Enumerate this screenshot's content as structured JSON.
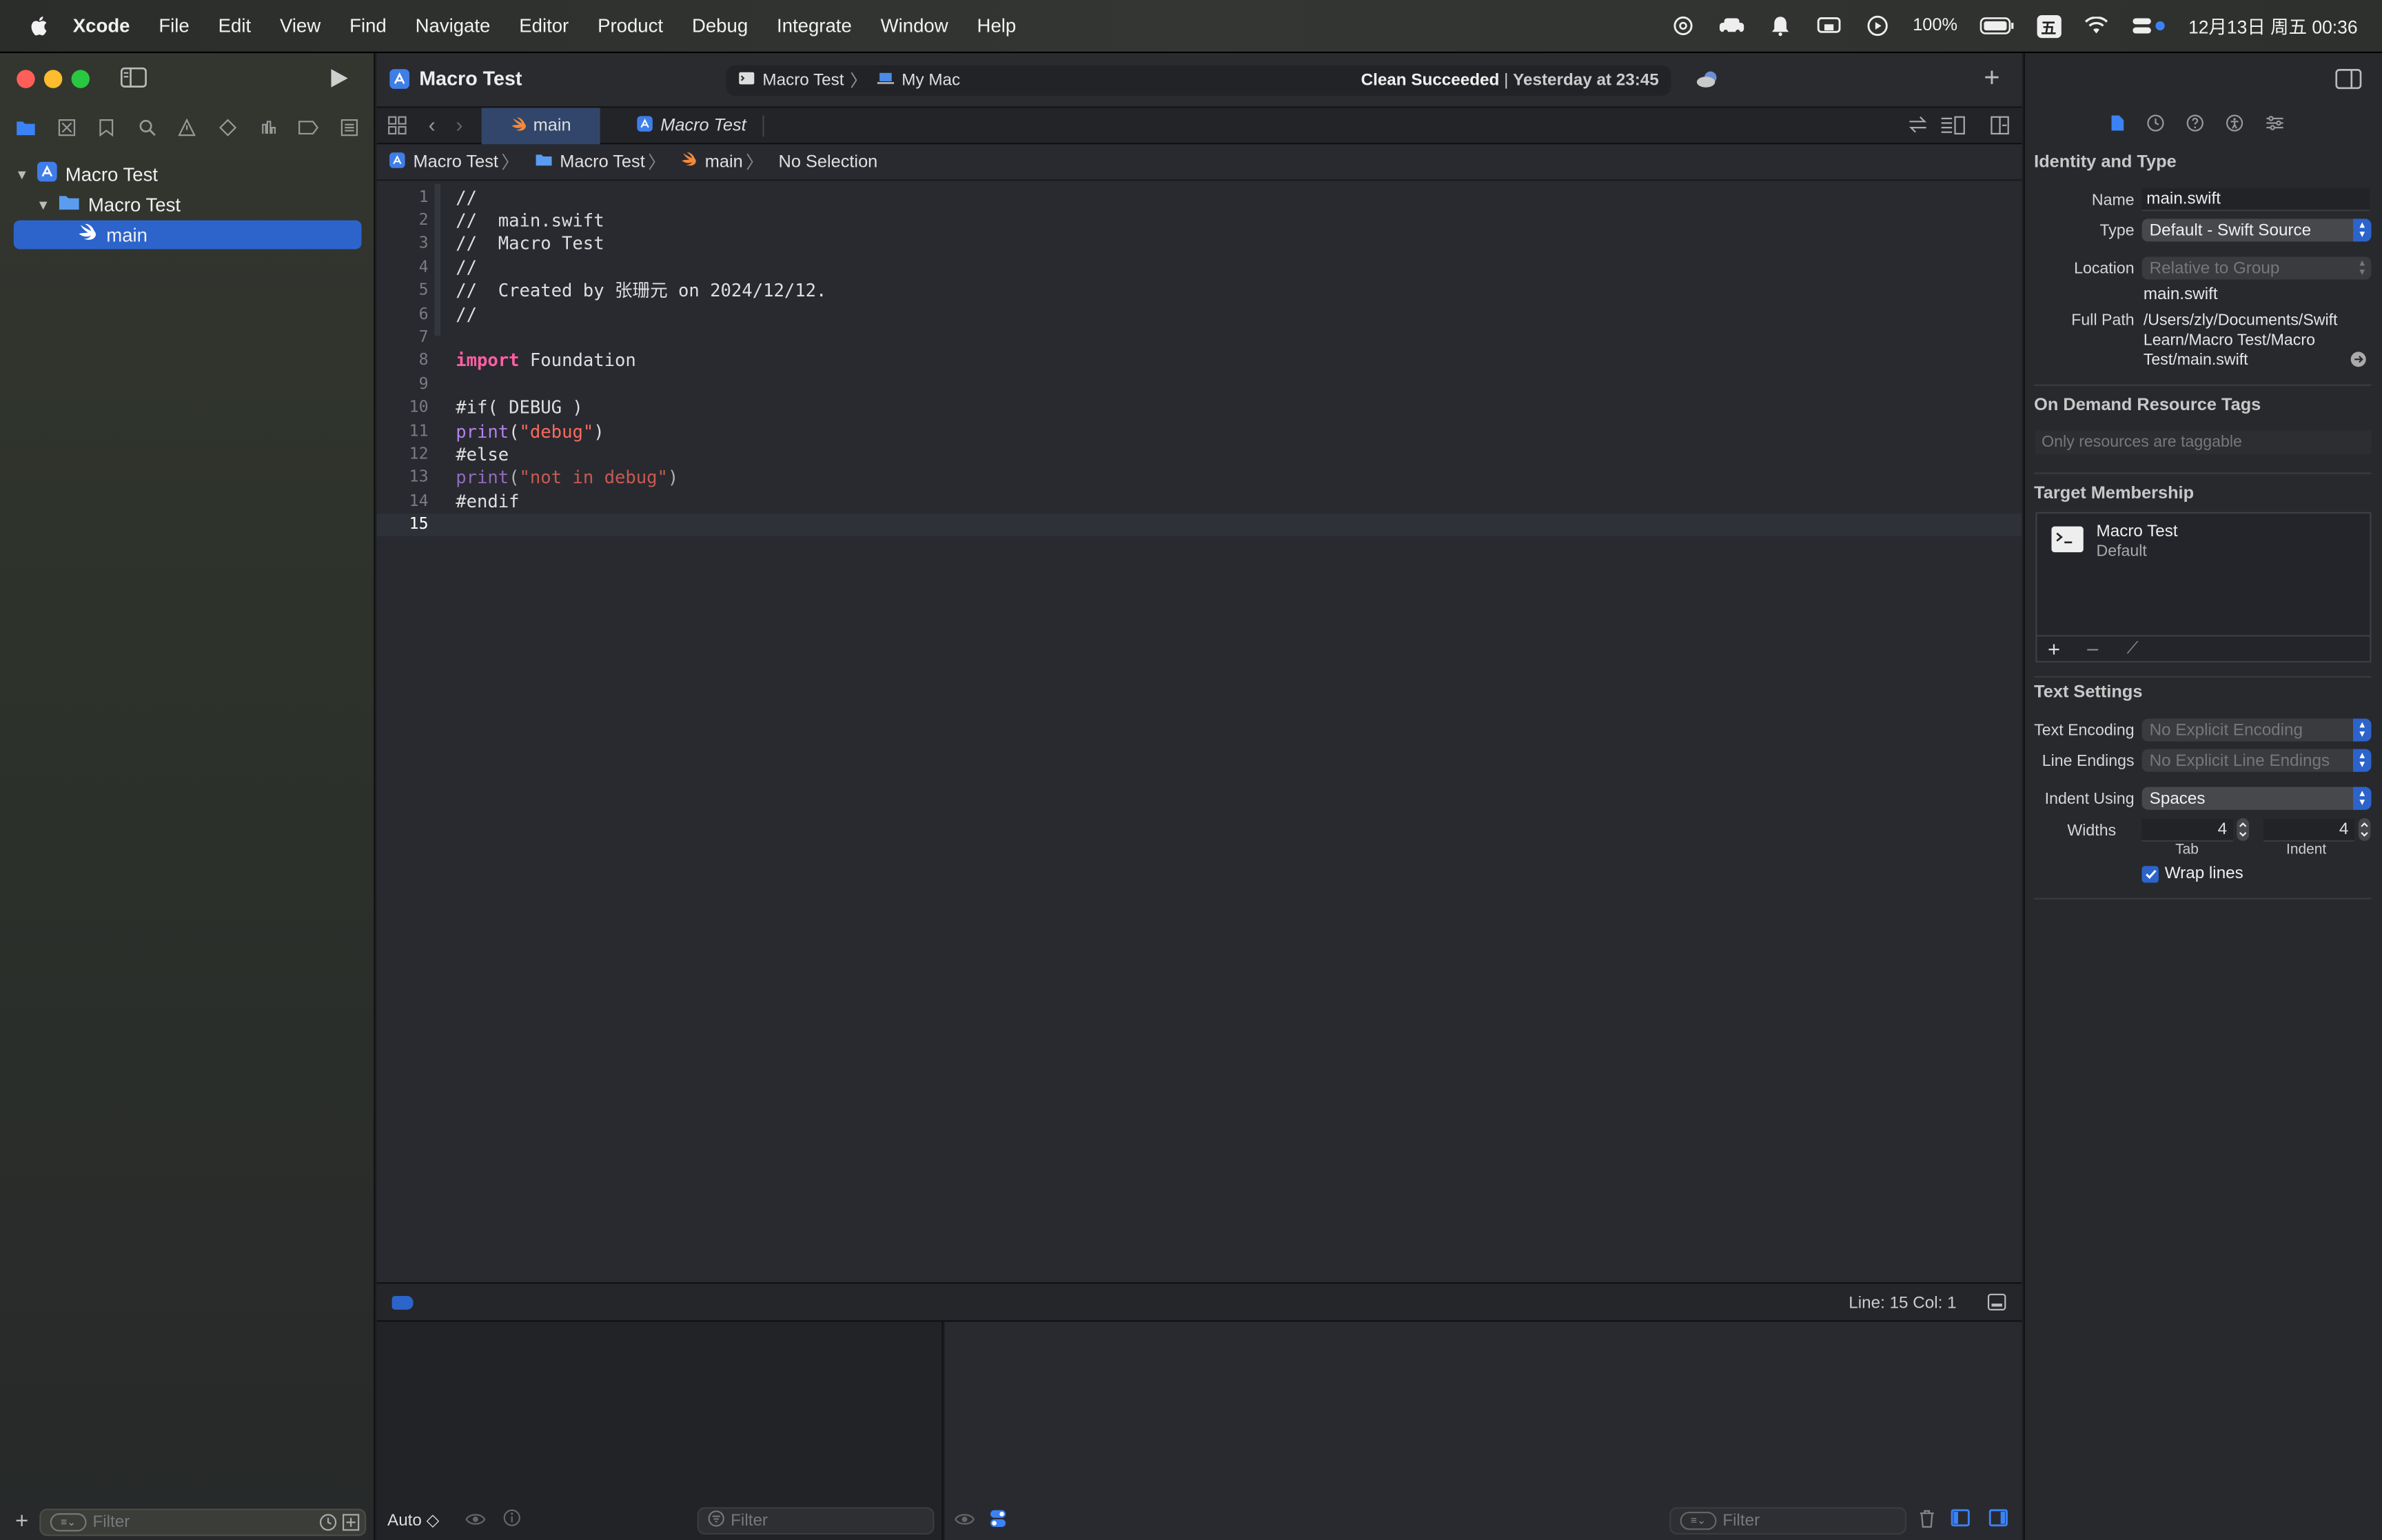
{
  "menubar": {
    "app": "Xcode",
    "items": [
      "File",
      "Edit",
      "View",
      "Find",
      "Navigate",
      "Editor",
      "Product",
      "Debug",
      "Integrate",
      "Window",
      "Help"
    ],
    "battery": "100%",
    "input_method": "五",
    "datetime": "12月13日 周五 00:36"
  },
  "toolbar": {
    "project_title": "Macro Test",
    "scheme": "Macro Test",
    "destination": "My Mac",
    "status_main": "Clean Succeeded",
    "status_sep": " | ",
    "status_time": "Yesterday at 23:45"
  },
  "navigator": {
    "items": [
      {
        "label": "Macro Test"
      },
      {
        "label": "Macro Test"
      },
      {
        "label": "main"
      }
    ],
    "filter_placeholder": "Filter"
  },
  "tabs": {
    "active": "main",
    "inactive": "Macro Test"
  },
  "jumpbar": {
    "project": "Macro Test",
    "group": "Macro Test",
    "file": "main",
    "selection": "No Selection"
  },
  "code": {
    "lines": [
      {
        "n": "1",
        "t": "//"
      },
      {
        "n": "2",
        "t": "//  main.swift"
      },
      {
        "n": "3",
        "t": "//  Macro Test"
      },
      {
        "n": "4",
        "t": "//"
      },
      {
        "n": "5",
        "t": "//  Created by 张珊元 on 2024/12/12."
      },
      {
        "n": "6",
        "t": "//"
      },
      {
        "n": "7",
        "t": ""
      },
      {
        "n": "8",
        "kw": "import",
        "rest": " Foundation"
      },
      {
        "n": "9",
        "t": ""
      },
      {
        "n": "10",
        "pp": "#if( DEBUG )"
      },
      {
        "n": "11",
        "fn": "print",
        "p1": "(",
        "str": "\"debug\"",
        "p2": ")"
      },
      {
        "n": "12",
        "pp": "#else"
      },
      {
        "n": "13",
        "fn": "print",
        "p1": "(",
        "str": "\"not in debug\"",
        "p2": ")"
      },
      {
        "n": "14",
        "pp": "#endif"
      },
      {
        "n": "15",
        "t": ""
      }
    ]
  },
  "statusbar": {
    "line_col": "Line: 15  Col: 1"
  },
  "debug": {
    "auto": "Auto ◇",
    "filter_placeholder": "Filter"
  },
  "inspector": {
    "identity_title": "Identity and Type",
    "name_label": "Name",
    "name_value": "main.swift",
    "type_label": "Type",
    "type_value": "Default - Swift Source",
    "location_label": "Location",
    "location_value": "Relative to Group",
    "location_file": "main.swift",
    "fullpath_label": "Full Path",
    "fullpath_1": "/Users/zly/Documents/Swift",
    "fullpath_2": "Learn/Macro Test/Macro",
    "fullpath_3": "Test/main.swift",
    "odr_title": "On Demand Resource Tags",
    "odr_placeholder": "Only resources are taggable",
    "target_title": "Target Membership",
    "target_name": "Macro Test",
    "target_sub": "Default",
    "text_title": "Text Settings",
    "encoding_label": "Text Encoding",
    "encoding_value": "No Explicit Encoding",
    "endings_label": "Line Endings",
    "endings_value": "No Explicit Line Endings",
    "indent_label": "Indent Using",
    "indent_value": "Spaces",
    "widths_label": "Widths",
    "tab_width": "4",
    "indent_width": "4",
    "tab_caption": "Tab",
    "indent_caption": "Indent",
    "wrap_label": "Wrap lines"
  },
  "colors": {
    "accent": "#2c64cc",
    "keyword": "#fc5fa3",
    "preprocessor": "#fd8f3f",
    "function": "#b281eb",
    "string": "#fc6a5d",
    "comment": "#7f8c98"
  }
}
